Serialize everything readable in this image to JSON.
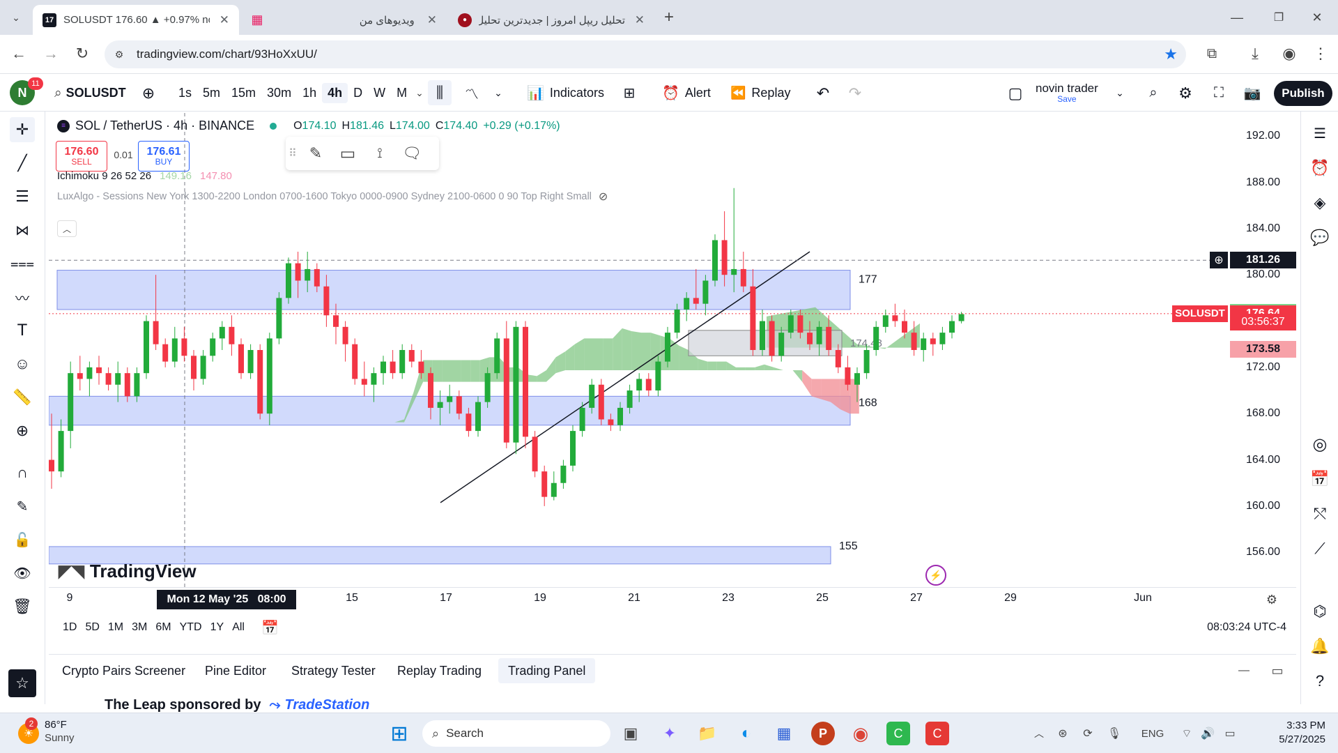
{
  "browser": {
    "tabs": [
      {
        "title": "SOLUSDT 176.60 ▲ +0.97% nov",
        "active": true
      },
      {
        "title": "ویدیوهای من",
        "active": false
      },
      {
        "title": "تحلیل ریپل امروز | جدیدترین تحلیل",
        "active": false
      }
    ],
    "url": "tradingview.com/chart/93HoXxUU/",
    "new_tab": "+",
    "close_glyph": "✕"
  },
  "header": {
    "avatar_letter": "N",
    "notif_count": "11",
    "symbol": "SOLUSDT",
    "intervals": [
      "1s",
      "5m",
      "15m",
      "30m",
      "1h",
      "4h",
      "D",
      "W",
      "M"
    ],
    "active_interval": "4h",
    "indicators": "Indicators",
    "alert": "Alert",
    "replay": "Replay",
    "account": "novin trader",
    "save": "Save",
    "publish": "Publish"
  },
  "legend": {
    "title": "SOL / TetherUS · 4h · BINANCE",
    "ohlc": [
      {
        "k": "O",
        "v": "174.10"
      },
      {
        "k": "H",
        "v": "181.46"
      },
      {
        "k": "L",
        "v": "174.00"
      },
      {
        "k": "C",
        "v": "174.40"
      }
    ],
    "change": "+0.29 (+0.17%)",
    "sell_price": "176.60",
    "sell_label": "SELL",
    "spread": "0.01",
    "buy_price": "176.61",
    "buy_label": "BUY",
    "ichimoku": "Ichimoku 9 26 52 26",
    "ichi_v1": "149.16",
    "ichi_v2": "147.80",
    "luxalgo": "LuxAlgo - Sessions New York 1300-2200 London 0700-1600 Tokyo 0000-0900 Sydney 2100-0600 0 90 Top Right Small"
  },
  "chart_data": {
    "type": "candlestick",
    "symbol": "SOL / TetherUS",
    "interval": "4h",
    "exchange": "BINANCE",
    "y_ticks": [
      "192.00",
      "188.00",
      "184.00",
      "180.00",
      "176.00",
      "172.00",
      "168.00",
      "164.00",
      "160.00",
      "156.00"
    ],
    "ylim": [
      153,
      194
    ],
    "x_ticks": [
      "9",
      "15",
      "17",
      "19",
      "21",
      "23",
      "25",
      "27",
      "29",
      "Jun"
    ],
    "crosshair_x_label": "Mon 12 May '25",
    "crosshair_time": "08:00",
    "crosshair_price": "181.26",
    "zones": [
      {
        "label": "177",
        "from": 177,
        "to": 180.4
      },
      {
        "label": "168",
        "from": 167,
        "to": 169.5
      },
      {
        "label": "155",
        "from": 155,
        "to": 156.5
      }
    ],
    "grey_zone_label": "174.48",
    "price_labels": [
      {
        "text": "176.78",
        "color": "#7ed38a"
      },
      {
        "text": "SOLUSDT",
        "color": "#f23645"
      },
      {
        "text": "176.64",
        "color": "#f23645"
      },
      {
        "text": "03:56:37",
        "color": "#f23645"
      },
      {
        "text": "173.58",
        "color": "#f7a1a8"
      }
    ],
    "candles": [
      [
        164.0,
        168.0,
        161.5,
        163.0
      ],
      [
        163.0,
        167.5,
        162.5,
        166.5
      ],
      [
        166.5,
        172.5,
        165.0,
        171.5
      ],
      [
        171.5,
        173.0,
        170.0,
        171.0
      ],
      [
        171.0,
        172.5,
        169.5,
        172.0
      ],
      [
        172.0,
        173.0,
        170.5,
        171.5
      ],
      [
        171.5,
        172.0,
        170.0,
        170.5
      ],
      [
        170.5,
        172.5,
        169.0,
        171.5
      ],
      [
        171.5,
        172.0,
        169.0,
        169.5
      ],
      [
        169.5,
        172.0,
        169.0,
        171.5
      ],
      [
        171.5,
        176.5,
        171.0,
        176.0
      ],
      [
        176.0,
        180.0,
        173.5,
        174.0
      ],
      [
        174.0,
        174.5,
        172.0,
        172.5
      ],
      [
        172.5,
        175.5,
        172.0,
        174.5
      ],
      [
        174.5,
        175.5,
        172.5,
        173.0
      ],
      [
        173.0,
        173.5,
        170.0,
        171.0
      ],
      [
        171.0,
        173.5,
        170.5,
        173.0
      ],
      [
        173.0,
        175.0,
        172.5,
        174.5
      ],
      [
        174.5,
        176.0,
        173.5,
        175.5
      ],
      [
        175.5,
        176.5,
        173.0,
        174.0
      ],
      [
        174.0,
        174.5,
        171.0,
        171.5
      ],
      [
        171.5,
        174.0,
        171.0,
        173.5
      ],
      [
        173.5,
        174.0,
        167.5,
        168.0
      ],
      [
        168.0,
        175.0,
        167.0,
        174.5
      ],
      [
        174.5,
        178.5,
        174.0,
        178.0
      ],
      [
        178.0,
        181.5,
        177.5,
        181.0
      ],
      [
        181.0,
        182.0,
        178.0,
        179.5
      ],
      [
        179.5,
        182.0,
        178.5,
        180.5
      ],
      [
        180.5,
        181.0,
        178.5,
        179.0
      ],
      [
        179.0,
        180.0,
        175.5,
        176.5
      ],
      [
        176.5,
        177.5,
        174.0,
        175.5
      ],
      [
        175.5,
        176.0,
        172.5,
        174.0
      ],
      [
        174.0,
        174.5,
        170.5,
        171.0
      ],
      [
        171.0,
        172.5,
        169.5,
        170.5
      ],
      [
        170.5,
        172.0,
        169.0,
        171.5
      ],
      [
        171.5,
        173.0,
        170.5,
        172.5
      ],
      [
        172.5,
        173.5,
        171.0,
        171.5
      ],
      [
        171.5,
        174.0,
        171.0,
        173.5
      ],
      [
        173.5,
        174.0,
        172.0,
        172.5
      ],
      [
        172.5,
        173.5,
        171.0,
        171.5
      ],
      [
        171.5,
        172.0,
        167.5,
        168.5
      ],
      [
        168.5,
        170.0,
        167.0,
        169.0
      ],
      [
        169.0,
        170.5,
        168.0,
        169.5
      ],
      [
        169.5,
        170.0,
        167.5,
        168.0
      ],
      [
        168.0,
        168.5,
        166.0,
        166.5
      ],
      [
        166.5,
        169.5,
        166.0,
        169.0
      ],
      [
        169.0,
        172.0,
        168.5,
        171.5
      ],
      [
        171.5,
        175.0,
        171.0,
        174.5
      ],
      [
        174.5,
        176.0,
        165.0,
        165.5
      ],
      [
        165.5,
        176.0,
        164.5,
        175.5
      ],
      [
        175.5,
        176.0,
        165.0,
        166.0
      ],
      [
        166.0,
        166.5,
        162.5,
        163.0
      ],
      [
        163.0,
        163.5,
        160.0,
        160.8
      ],
      [
        160.8,
        163.0,
        160.5,
        162.0
      ],
      [
        162.0,
        164.0,
        161.5,
        163.5
      ],
      [
        163.5,
        167.0,
        163.0,
        166.5
      ],
      [
        166.5,
        169.0,
        166.0,
        168.5
      ],
      [
        168.5,
        171.0,
        168.0,
        170.5
      ],
      [
        170.5,
        171.0,
        167.0,
        167.5
      ],
      [
        167.5,
        168.0,
        166.5,
        167.0
      ],
      [
        167.0,
        169.0,
        166.5,
        168.5
      ],
      [
        168.5,
        170.5,
        168.0,
        170.0
      ],
      [
        170.0,
        171.5,
        169.0,
        171.0
      ],
      [
        171.0,
        171.5,
        169.5,
        170.0
      ],
      [
        170.0,
        173.0,
        169.5,
        172.5
      ],
      [
        172.5,
        175.5,
        172.0,
        175.0
      ],
      [
        175.0,
        177.5,
        174.5,
        177.0
      ],
      [
        177.0,
        178.5,
        176.0,
        178.0
      ],
      [
        178.0,
        180.5,
        177.0,
        177.5
      ],
      [
        177.5,
        180.0,
        176.5,
        179.5
      ],
      [
        179.5,
        183.5,
        179.0,
        183.0
      ],
      [
        183.0,
        185.5,
        179.0,
        180.0
      ],
      [
        180.0,
        187.5,
        178.5,
        180.5
      ],
      [
        180.5,
        182.0,
        178.5,
        179.0
      ],
      [
        179.0,
        180.5,
        173.0,
        173.5
      ],
      [
        173.5,
        177.0,
        173.0,
        176.0
      ],
      [
        176.0,
        176.5,
        172.5,
        173.0
      ],
      [
        173.0,
        175.5,
        172.5,
        175.0
      ],
      [
        175.0,
        177.0,
        174.5,
        176.5
      ],
      [
        176.5,
        177.0,
        174.5,
        175.0
      ],
      [
        175.0,
        176.0,
        173.5,
        174.0
      ],
      [
        174.0,
        176.0,
        173.0,
        175.5
      ],
      [
        175.5,
        176.5,
        173.0,
        173.5
      ],
      [
        173.5,
        174.0,
        171.5,
        172.0
      ],
      [
        172.0,
        173.0,
        170.0,
        170.5
      ],
      [
        170.5,
        172.0,
        169.0,
        171.5
      ],
      [
        171.5,
        174.0,
        171.0,
        173.5
      ],
      [
        173.5,
        176.0,
        173.0,
        175.5
      ],
      [
        175.5,
        177.0,
        175.0,
        176.5
      ],
      [
        176.5,
        177.5,
        175.5,
        176.0
      ],
      [
        176.0,
        177.0,
        174.5,
        175.0
      ],
      [
        175.0,
        176.0,
        173.0,
        173.5
      ],
      [
        173.5,
        175.0,
        172.5,
        174.5
      ],
      [
        174.5,
        175.0,
        173.0,
        174.0
      ],
      [
        174.0,
        175.5,
        173.5,
        175.0
      ],
      [
        175.0,
        176.5,
        174.5,
        176.0
      ],
      [
        176.0,
        176.8,
        175.8,
        176.6
      ]
    ]
  },
  "tv_logo": "TradingView",
  "range_buttons": [
    "1D",
    "5D",
    "1M",
    "3M",
    "6M",
    "YTD",
    "1Y",
    "All"
  ],
  "clock": "08:03:24 UTC-4",
  "bottom_tabs": [
    "Crypto Pairs Screener",
    "Pine Editor",
    "Strategy Tester",
    "Replay Trading",
    "Trading Panel"
  ],
  "active_bottom_tab": "Trading Panel",
  "promo": "The Leap sponsored by",
  "promo_brand": "TradeStation",
  "taskbar": {
    "weather_temp": "86°F",
    "weather_cond": "Sunny",
    "weather_badge": "2",
    "search": "Search",
    "lang": "ENG",
    "time": "3:33 PM",
    "date": "5/27/2025"
  },
  "colors": {
    "up": "#22ab3a",
    "down": "#f23645",
    "zone": "#c9d3fb",
    "cloud_green": "#81c784",
    "cloud_red": "#f28b92",
    "accent": "#2962ff"
  }
}
